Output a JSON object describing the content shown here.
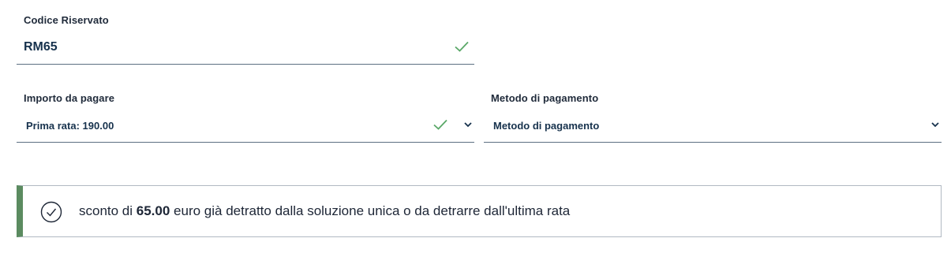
{
  "codice": {
    "label": "Codice Riservato",
    "value": "RM65",
    "status_icon": "check-icon"
  },
  "importo": {
    "label": "Importo da pagare",
    "value": "Prima rata: 190.00",
    "status_icon": "check-icon",
    "dropdown_icon": "chevron-down-icon"
  },
  "metodo": {
    "label": "Metodo di pagamento",
    "value": "Metodo di pagamento",
    "dropdown_icon": "chevron-down-icon"
  },
  "alert": {
    "icon": "check-circle-icon",
    "text_before": "sconto di ",
    "amount": "65.00",
    "text_after": " euro già detratto dalla soluzione unica o da detrarre dall'ultima rata"
  },
  "colors": {
    "success_check": "#5aa868",
    "alert_border": "#5b8b60",
    "text_primary": "#17324d",
    "field_underline": "#5c6f82"
  }
}
